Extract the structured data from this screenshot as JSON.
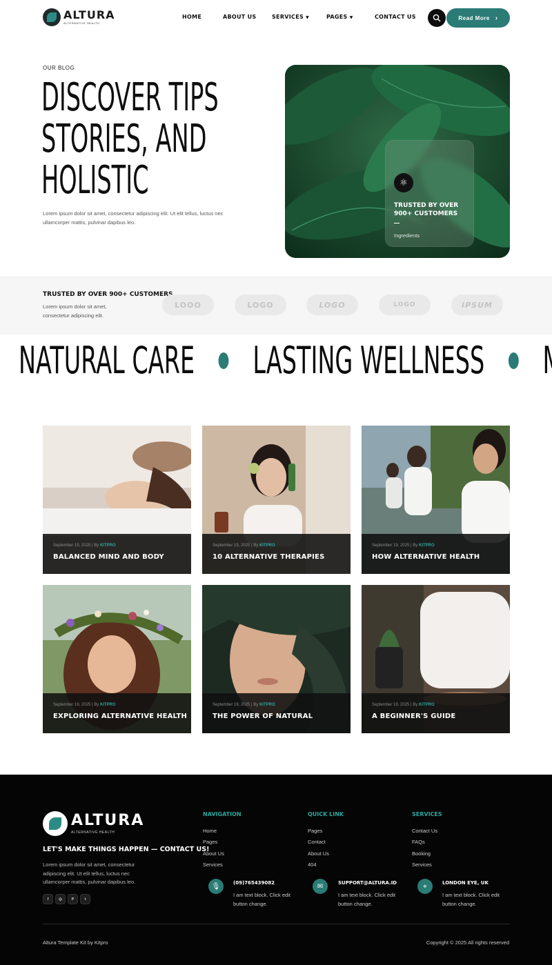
{
  "header": {
    "logo": {
      "title": "ALTURA",
      "subtitle": "ALTERNATIVE HEALTH"
    },
    "nav": [
      {
        "label": "HOME",
        "dropdown": false
      },
      {
        "label": "ABOUT US",
        "dropdown": false
      },
      {
        "label": "SERVICES",
        "dropdown": true
      },
      {
        "label": "PAGES",
        "dropdown": true
      },
      {
        "label": "CONTACT US",
        "dropdown": false
      }
    ],
    "cta_label": "Read More"
  },
  "hero": {
    "eyebrow": "OUR BLOG",
    "title_line1": "DISCOVER TIPS",
    "title_line2": "STORIES, AND",
    "title_line3": "HOLISTIC",
    "text": "Lorem ipsum dolor sit amet, consectetur adipiscing elit. Ut elit tellus, luctus nec ullamcorper mattis, pulvinar dapibus leo.",
    "card_title": "TRUSTED BY OVER 900+ CUSTOMERS",
    "card_sub": "Ingredients"
  },
  "trusted": {
    "title": "TRUSTED BY OVER 900+ CUSTOMERS",
    "text": "Lorem ipsum dolor sit amet, consectetur adipiscing elit.",
    "brands": [
      "LOOO",
      "LOGO",
      "LOGO",
      "LOGO",
      "IPSUM"
    ]
  },
  "marquee": [
    "NATURAL CARE",
    "LASTING WELLNESS",
    "MODERN WELLNESS"
  ],
  "posts": [
    {
      "date": "September 19, 2025",
      "sep": " | By ",
      "author": "KITPRO",
      "title": "BALANCED MIND AND BODY"
    },
    {
      "date": "September 19, 2025",
      "sep": " | By ",
      "author": "KITPRO",
      "title": "10 ALTERNATIVE THERAPIES"
    },
    {
      "date": "September 19, 2025",
      "sep": " | By ",
      "author": "KITPRO",
      "title": "HOW ALTERNATIVE HEALTH"
    },
    {
      "date": "September 19, 2025",
      "sep": " | By ",
      "author": "KITPRO",
      "title": "EXPLORING ALTERNATIVE HEALTH"
    },
    {
      "date": "September 19, 2025",
      "sep": " | By ",
      "author": "KITPRO",
      "title": "THE POWER OF NATURAL"
    },
    {
      "date": "September 19, 2025",
      "sep": " | By ",
      "author": "KITPRO",
      "title": "A BEGINNER'S GUIDE"
    }
  ],
  "footer": {
    "logo": {
      "title": "ALTURA",
      "subtitle": "ALTERNATIVE HEALTH"
    },
    "tagline": "LET'S MAKE THINGS HAPPEN — CONTACT US!",
    "text": "Lorem ipsum dolor sit amet, consectetur adipiscing elit. Ut elit tellus, luctus nec ullamcorper mattis, pulvinar dapibus leo.",
    "social": [
      "f",
      "◎",
      "P",
      "t"
    ],
    "columns": [
      {
        "title": "NAVIGATION",
        "items": [
          "Home",
          "Pages",
          "About Us",
          "Services"
        ]
      },
      {
        "title": "QUICK LINK",
        "items": [
          "Pages",
          "Contact",
          "About Us",
          "404"
        ]
      },
      {
        "title": "SERVICES",
        "items": [
          "Contact Us",
          "FAQs",
          "Booking",
          "Services"
        ]
      }
    ],
    "contacts": [
      {
        "icon": "microphone-icon",
        "head": "(09)765439082",
        "body": "I am text block. Click edit button  change."
      },
      {
        "icon": "envelope-icon",
        "head": "SUPPORT@ALTURA.ID",
        "body": "I am text block. Click edit button  change."
      },
      {
        "icon": "location-pin-icon",
        "head": "LONDON EYE, UK",
        "body": "I am text block. Click edit button  change."
      }
    ],
    "credit": "Altura Template Kit by Kitpro",
    "copyright": "Copyright © 2025 All rights reserved"
  },
  "colors": {
    "accent": "#2b7b76",
    "accent_text": "#2ba79d",
    "dark": "#050505"
  }
}
